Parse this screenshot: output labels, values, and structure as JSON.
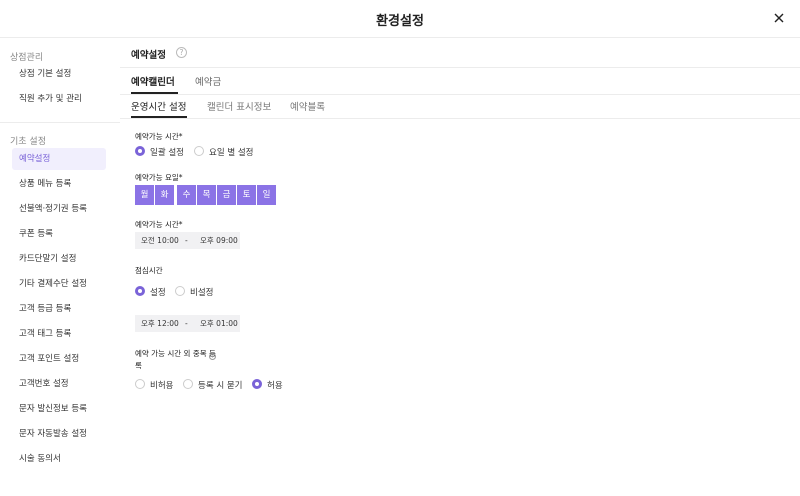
{
  "header": {
    "title": "환경설정",
    "close_icon": "close-icon"
  },
  "sidebar": {
    "group1": "상점관리",
    "group1_items": [
      "상점 기본 설정",
      "직원 추가 및 관리"
    ],
    "group2": "기초 설정",
    "group2_items": [
      "예약설정",
      "상품 메뉴 등록",
      "선불액·정기권 등록",
      "쿠폰 등록",
      "카드단말기 설정",
      "기타 결제수단 설정",
      "고객 등급 등록",
      "고객 태그 등록",
      "고객 포인트 설정",
      "고객번호 설정",
      "문자 발신정보 등록",
      "문자 자동발송 설정",
      "시술 동의서"
    ],
    "active_item": "예약설정"
  },
  "main": {
    "section_title": "예약설정",
    "help_icon": "?",
    "tabs": [
      "예약캘린더",
      "예약금"
    ],
    "subtabs": [
      "운영시간 설정",
      "캘린더 표시정보",
      "예약블록"
    ],
    "available_time_type": {
      "label": "예약가능 시간*",
      "options": [
        "일괄 설정",
        "요일 별 설정"
      ],
      "selected": "일괄 설정"
    },
    "available_days": {
      "label": "예약가능 요일*",
      "days": [
        "월",
        "화",
        "수",
        "목",
        "금",
        "토",
        "일"
      ]
    },
    "available_hours": {
      "label": "예약가능 시간*",
      "start": "오전 10:00",
      "separator": "-",
      "end": "오후 09:00"
    },
    "lunch": {
      "label": "점심시간",
      "options": [
        "설정",
        "비설정"
      ],
      "selected": "설정",
      "start": "오후 12:00",
      "separator": "-",
      "end": "오후 01:00"
    },
    "duplicate": {
      "label_line1": "예약 가능 시간 외 중복 등",
      "label_line2": "록",
      "info_icon": "i",
      "options": [
        "비허용",
        "등록 시 묻기",
        "허용"
      ],
      "selected": "허용"
    }
  },
  "colors": {
    "accent": "#7a63d8",
    "day_chip": "#8b73e6",
    "active_bg": "#f1effd"
  }
}
